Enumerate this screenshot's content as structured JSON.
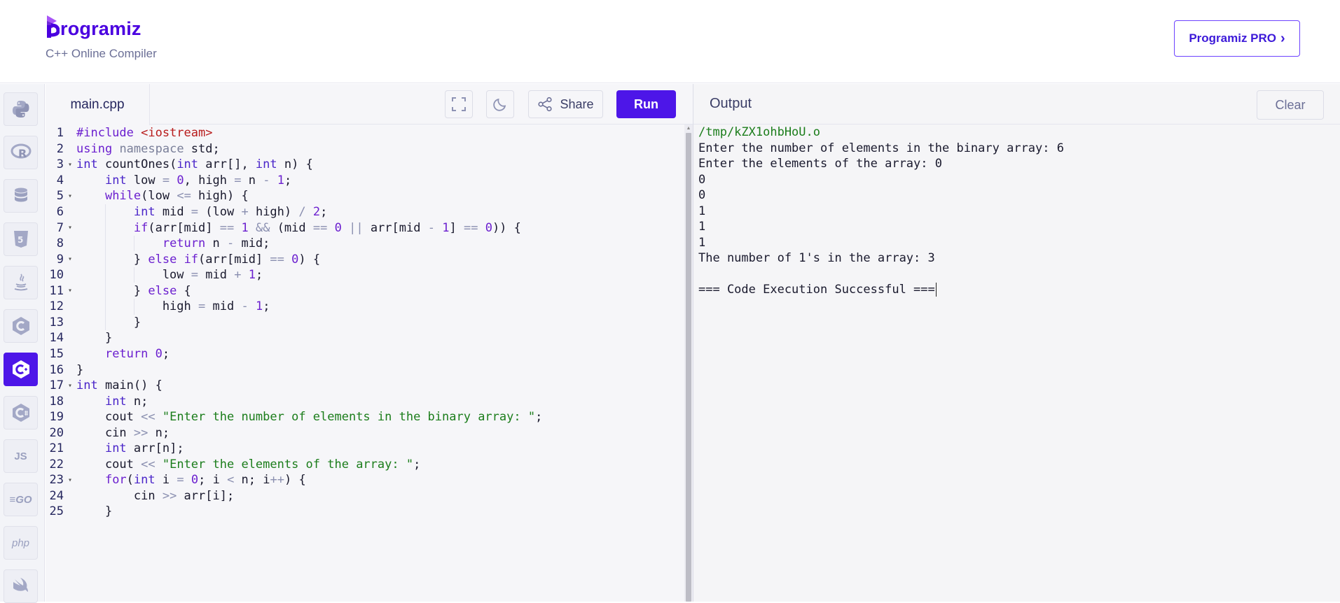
{
  "header": {
    "logo_text": "rogramiz",
    "subtitle": "C++ Online Compiler",
    "pro_button": "Programiz PRO",
    "pro_chevron": "›"
  },
  "sidebar": {
    "items": [
      {
        "name": "python-icon"
      },
      {
        "name": "r-icon"
      },
      {
        "name": "sql-icon"
      },
      {
        "name": "html-icon"
      },
      {
        "name": "java-icon"
      },
      {
        "name": "c-icon"
      },
      {
        "name": "cpp-icon",
        "active": true
      },
      {
        "name": "csharp-icon"
      },
      {
        "name": "js-icon",
        "label": "JS"
      },
      {
        "name": "go-icon",
        "label": "GO"
      },
      {
        "name": "php-icon",
        "label": "php"
      },
      {
        "name": "swift-icon"
      }
    ]
  },
  "editor": {
    "file_tab": "main.cpp",
    "share_label": "Share",
    "run_label": "Run",
    "lines": [
      "#include <iostream>",
      "using namespace std;",
      "int countOnes(int arr[], int n) {",
      "    int low = 0, high = n - 1;",
      "    while(low <= high) {",
      "        int mid = (low + high) / 2;",
      "        if(arr[mid] == 1 && (mid == 0 || arr[mid - 1] == 0)) {",
      "            return n - mid;",
      "        } else if(arr[mid] == 0) {",
      "            low = mid + 1;",
      "        } else {",
      "            high = mid - 1;",
      "        }",
      "    }",
      "    return 0;",
      "}",
      "int main() {",
      "    int n;",
      "    cout << \"Enter the number of elements in the binary array: \";",
      "    cin >> n;",
      "    int arr[n];",
      "    cout << \"Enter the elements of the array: \";",
      "    for(int i = 0; i < n; i++) {",
      "        cin >> arr[i];",
      "    }"
    ],
    "fold_lines": [
      3,
      5,
      7,
      9,
      11,
      17,
      23
    ]
  },
  "output": {
    "title": "Output",
    "clear_label": "Clear",
    "path": "/tmp/kZX1ohbHoU.o",
    "lines": [
      "Enter the number of elements in the binary array: 6",
      "Enter the elements of the array: 0",
      "0",
      "0",
      "1",
      "1",
      "1",
      "The number of 1's in the array: 3",
      "",
      "=== Code Execution Successful ==="
    ]
  }
}
